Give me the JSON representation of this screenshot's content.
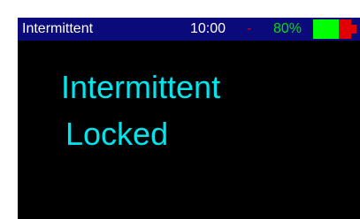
{
  "status_bar": {
    "title": "Intermittent",
    "time": "10:00",
    "indicator": "-",
    "battery_percent": "80%",
    "battery_level": 0.8,
    "colors": {
      "bar_background": "#0a0a7a",
      "title_text": "#ffffff",
      "indicator": "#e00000",
      "battery_text": "#00e000",
      "battery_fill": "#00ff00",
      "battery_empty": "#e00000"
    }
  },
  "main": {
    "line1": "Intermittent",
    "line2": "Locked",
    "text_color": "#00e5ee",
    "background": "#000000"
  }
}
